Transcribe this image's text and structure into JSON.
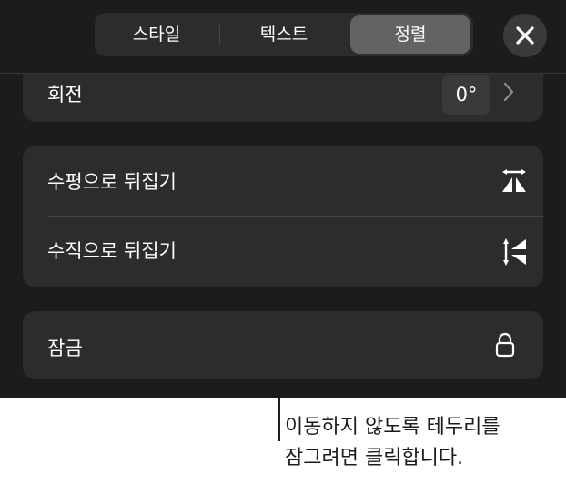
{
  "tabs": [
    {
      "label": "스타일",
      "active": false
    },
    {
      "label": "텍스트",
      "active": false
    },
    {
      "label": "정렬",
      "active": true
    }
  ],
  "close_icon": "close-icon",
  "rotation": {
    "label": "회전",
    "value": "0°",
    "icon": "chevron-right-icon"
  },
  "flip": {
    "horizontal_label": "수평으로 뒤집기",
    "horizontal_icon": "flip-horizontal-icon",
    "vertical_label": "수직으로 뒤집기",
    "vertical_icon": "flip-vertical-icon"
  },
  "lock": {
    "label": "잠금",
    "icon": "lock-icon"
  },
  "callout": {
    "line1": "이동하지 않도록 테두리를",
    "line2": "잠그려면 클릭합니다."
  },
  "colors": {
    "panel": "#1c1c1e",
    "group": "#2c2c2e",
    "active_tab": "#636366",
    "text": "#ffffff"
  }
}
